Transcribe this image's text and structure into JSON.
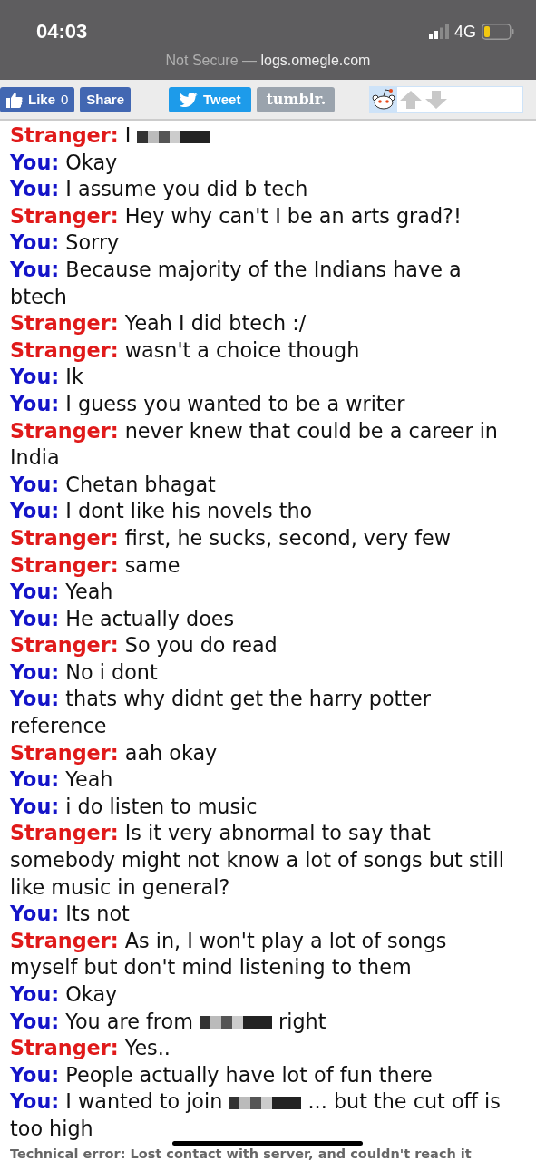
{
  "status_bar": {
    "time": "04:03",
    "network": "4G"
  },
  "address_bar": {
    "security": "Not Secure",
    "separator": "—",
    "domain": "logs.omegle.com"
  },
  "share_bar": {
    "like": {
      "label": "Like",
      "count": "0"
    },
    "share": {
      "label": "Share"
    },
    "tweet": {
      "label": "Tweet"
    },
    "tumblr": {
      "label": "tumblr."
    }
  },
  "messages": [
    {
      "sender": "Stranger:",
      "kind": "stranger",
      "parts": [
        {
          "kind": "text",
          "text": "I"
        },
        {
          "kind": "redaction"
        }
      ]
    },
    {
      "sender": "You:",
      "kind": "you",
      "parts": [
        {
          "kind": "text",
          "text": "Okay"
        }
      ]
    },
    {
      "sender": "You:",
      "kind": "you",
      "parts": [
        {
          "kind": "text",
          "text": "I assume you did b tech"
        }
      ]
    },
    {
      "sender": "Stranger:",
      "kind": "stranger",
      "parts": [
        {
          "kind": "text",
          "text": "Hey why can't I be an arts grad?!"
        }
      ]
    },
    {
      "sender": "You:",
      "kind": "you",
      "parts": [
        {
          "kind": "text",
          "text": "Sorry"
        }
      ]
    },
    {
      "sender": "You:",
      "kind": "you",
      "parts": [
        {
          "kind": "text",
          "text": "Because majority of the Indians have a btech"
        }
      ]
    },
    {
      "sender": "Stranger:",
      "kind": "stranger",
      "parts": [
        {
          "kind": "text",
          "text": "Yeah I did btech :/"
        }
      ]
    },
    {
      "sender": "Stranger:",
      "kind": "stranger",
      "parts": [
        {
          "kind": "text",
          "text": "wasn't a choice though"
        }
      ]
    },
    {
      "sender": "You:",
      "kind": "you",
      "parts": [
        {
          "kind": "text",
          "text": "Ik"
        }
      ]
    },
    {
      "sender": "You:",
      "kind": "you",
      "parts": [
        {
          "kind": "text",
          "text": "I guess you wanted to be a writer"
        }
      ]
    },
    {
      "sender": "Stranger:",
      "kind": "stranger",
      "parts": [
        {
          "kind": "text",
          "text": "never knew that could be a career in India"
        }
      ]
    },
    {
      "sender": "You:",
      "kind": "you",
      "parts": [
        {
          "kind": "text",
          "text": "Chetan bhagat"
        }
      ]
    },
    {
      "sender": "You:",
      "kind": "you",
      "parts": [
        {
          "kind": "text",
          "text": "I dont like his novels tho"
        }
      ]
    },
    {
      "sender": "Stranger:",
      "kind": "stranger",
      "parts": [
        {
          "kind": "text",
          "text": "first, he sucks, second, very few"
        }
      ]
    },
    {
      "sender": "Stranger:",
      "kind": "stranger",
      "parts": [
        {
          "kind": "text",
          "text": "same"
        }
      ]
    },
    {
      "sender": "You:",
      "kind": "you",
      "parts": [
        {
          "kind": "text",
          "text": "Yeah"
        }
      ]
    },
    {
      "sender": "You:",
      "kind": "you",
      "parts": [
        {
          "kind": "text",
          "text": "He actually does"
        }
      ]
    },
    {
      "sender": "Stranger:",
      "kind": "stranger",
      "parts": [
        {
          "kind": "text",
          "text": "So you do read"
        }
      ]
    },
    {
      "sender": "You:",
      "kind": "you",
      "parts": [
        {
          "kind": "text",
          "text": "No i dont"
        }
      ]
    },
    {
      "sender": "You:",
      "kind": "you",
      "parts": [
        {
          "kind": "text",
          "text": "thats why didnt get the harry potter reference"
        }
      ]
    },
    {
      "sender": "Stranger:",
      "kind": "stranger",
      "parts": [
        {
          "kind": "text",
          "text": "aah okay"
        }
      ]
    },
    {
      "sender": "You:",
      "kind": "you",
      "parts": [
        {
          "kind": "text",
          "text": "Yeah"
        }
      ]
    },
    {
      "sender": "You:",
      "kind": "you",
      "parts": [
        {
          "kind": "text",
          "text": "i do listen to music"
        }
      ]
    },
    {
      "sender": "Stranger:",
      "kind": "stranger",
      "parts": [
        {
          "kind": "text",
          "text": "Is it very abnormal to say that somebody might not know a lot of songs but still like music in general?"
        }
      ]
    },
    {
      "sender": "You:",
      "kind": "you",
      "parts": [
        {
          "kind": "text",
          "text": "Its not"
        }
      ]
    },
    {
      "sender": "Stranger:",
      "kind": "stranger",
      "parts": [
        {
          "kind": "text",
          "text": "As in, I won't play a lot of songs myself but don't mind listening to them"
        }
      ]
    },
    {
      "sender": "You:",
      "kind": "you",
      "parts": [
        {
          "kind": "text",
          "text": "Okay"
        }
      ]
    },
    {
      "sender": "You:",
      "kind": "you",
      "parts": [
        {
          "kind": "text",
          "text": "You are from"
        },
        {
          "kind": "redaction"
        },
        {
          "kind": "text",
          "text": "right"
        }
      ]
    },
    {
      "sender": "Stranger:",
      "kind": "stranger",
      "parts": [
        {
          "kind": "text",
          "text": "Yes.."
        }
      ]
    },
    {
      "sender": "You:",
      "kind": "you",
      "parts": [
        {
          "kind": "text",
          "text": "People actually have lot of fun there"
        }
      ]
    },
    {
      "sender": "You:",
      "kind": "you",
      "parts": [
        {
          "kind": "text",
          "text": "I wanted to join"
        },
        {
          "kind": "redaction"
        },
        {
          "kind": "text",
          "text": "... but the cut off is too high"
        }
      ]
    }
  ],
  "error": "Technical error: Lost contact with server, and couldn't reach it"
}
